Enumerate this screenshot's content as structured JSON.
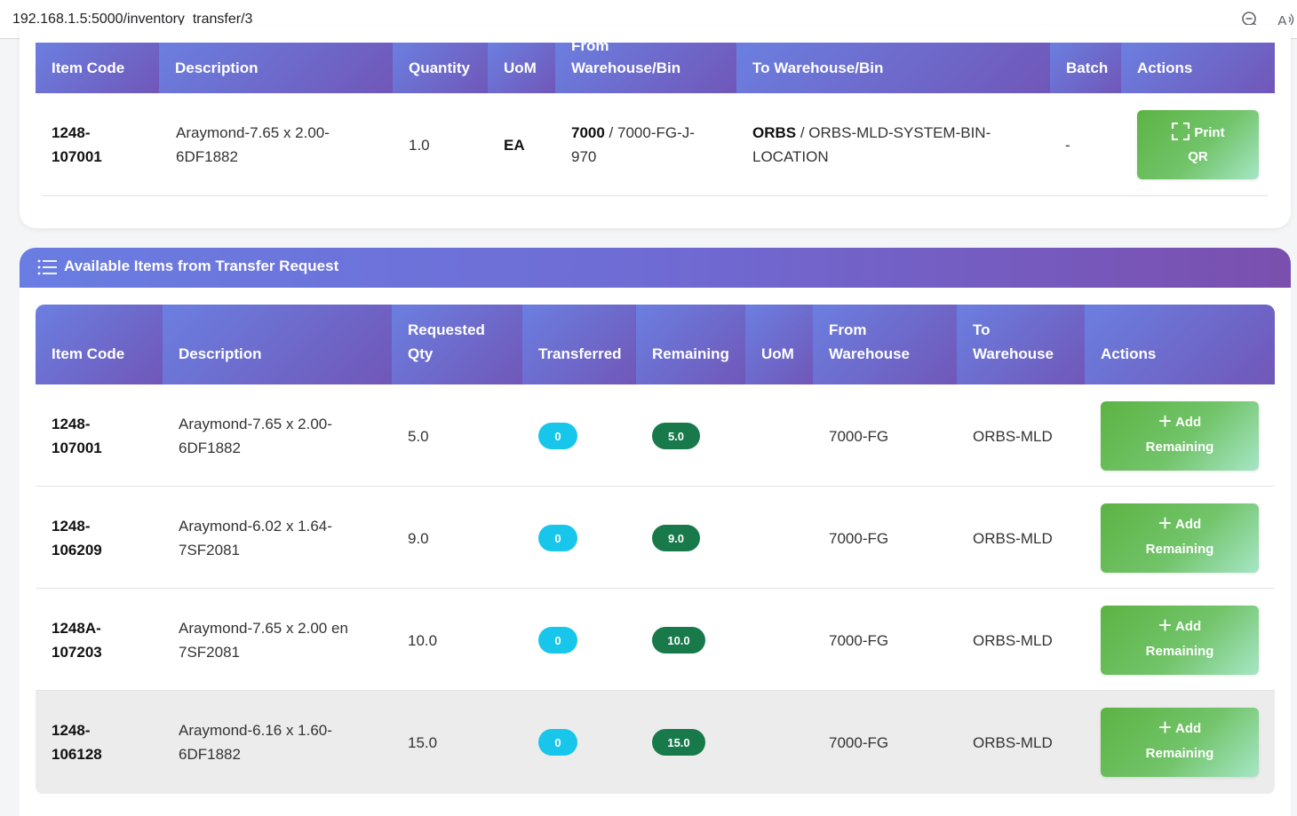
{
  "browser": {
    "url": "192.168.1.5:5000/inventory_transfer/3"
  },
  "transfer_items": {
    "headers": {
      "item_code": "Item Code",
      "description": "Description",
      "quantity": "Quantity",
      "uom": "UoM",
      "from_clip": "From",
      "from": "Warehouse/Bin",
      "to": "To Warehouse/Bin",
      "batch": "Batch",
      "actions": "Actions"
    },
    "rows": [
      {
        "item_code_1": "1248-",
        "item_code_2": "107001",
        "desc_1": "Araymond-7.65 x 2.00-",
        "desc_2": "6DF1882",
        "quantity": "1.0",
        "uom": "EA",
        "from_wh": "7000",
        "from_bin_1": " / 7000-FG-J-",
        "from_bin_2": "970",
        "to_wh": "ORBS",
        "to_bin_1": " / ORBS-MLD-SYSTEM-BIN-",
        "to_bin_2": "LOCATION",
        "batch": "-",
        "action_1": "Print",
        "action_2": "QR"
      }
    ]
  },
  "available": {
    "title": "Available Items from Transfer Request",
    "headers": {
      "item_code": "Item Code",
      "description": "Description",
      "requested_1": "Requested",
      "requested_2": "Qty",
      "transferred": "Transferred",
      "remaining": "Remaining",
      "uom": "UoM",
      "from_1": "From",
      "from_2": "Warehouse",
      "to_1": "To",
      "to_2": "Warehouse",
      "actions": "Actions"
    },
    "rows": [
      {
        "code_1": "1248-",
        "code_2": "107001",
        "desc_1": "Araymond-7.65 x 2.00-",
        "desc_2": "6DF1882",
        "requested": "5.0",
        "transferred": "0",
        "remaining": "5.0",
        "uom": "",
        "from": "7000-FG",
        "to": "ORBS-MLD",
        "btn_1": "Add",
        "btn_2": "Remaining"
      },
      {
        "code_1": "1248-",
        "code_2": "106209",
        "desc_1": "Araymond-6.02 x 1.64-",
        "desc_2": "7SF2081",
        "requested": "9.0",
        "transferred": "0",
        "remaining": "9.0",
        "uom": "",
        "from": "7000-FG",
        "to": "ORBS-MLD",
        "btn_1": "Add",
        "btn_2": "Remaining"
      },
      {
        "code_1": "1248A-",
        "code_2": "107203",
        "desc_1": "Araymond-7.65 x 2.00 en",
        "desc_2": "7SF2081",
        "requested": "10.0",
        "transferred": "0",
        "remaining": "10.0",
        "uom": "",
        "from": "7000-FG",
        "to": "ORBS-MLD",
        "btn_1": "Add",
        "btn_2": "Remaining"
      },
      {
        "code_1": "1248-",
        "code_2": "106128",
        "desc_1": "Araymond-6.16 x 1.60-",
        "desc_2": "6DF1882",
        "requested": "15.0",
        "transferred": "0",
        "remaining": "15.0",
        "uom": "",
        "from": "7000-FG",
        "to": "ORBS-MLD",
        "btn_1": "Add",
        "btn_2": "Remaining"
      }
    ]
  },
  "colors": {
    "header_start": "#6b7fe0",
    "header_end": "#7057b8",
    "pill_cyan": "#17c6ea",
    "pill_dark": "#18794a",
    "button_green": "#5cb343"
  }
}
